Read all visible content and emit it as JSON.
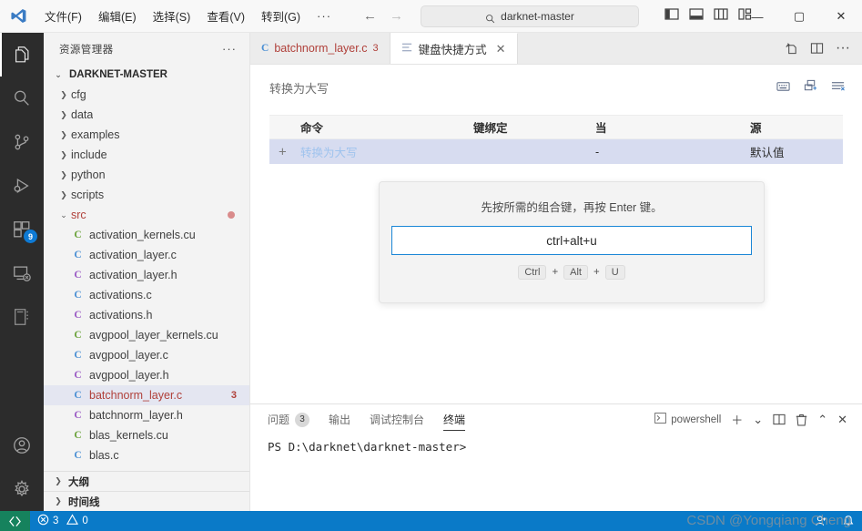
{
  "titlebar": {
    "menus": [
      "文件(F)",
      "编辑(E)",
      "选择(S)",
      "查看(V)",
      "转到(G)"
    ],
    "more": "···",
    "back_arrow": "←",
    "forward_arrow": "→",
    "search_text": "darknet-master",
    "minimize": "—",
    "maximize": "▢",
    "close": "✕"
  },
  "activitybar": {
    "items": [
      {
        "name": "explorer",
        "active": true
      },
      {
        "name": "search",
        "active": false
      },
      {
        "name": "source-control",
        "active": false
      },
      {
        "name": "run-debug",
        "active": false
      },
      {
        "name": "extensions",
        "active": false,
        "badge": "9"
      },
      {
        "name": "remote-explorer",
        "active": false
      },
      {
        "name": "notebook",
        "active": false
      }
    ],
    "bottom": [
      {
        "name": "accounts"
      },
      {
        "name": "settings"
      }
    ]
  },
  "sidebar": {
    "title": "资源管理器",
    "more": "···",
    "root": "DARKNET-MASTER",
    "folders": [
      {
        "label": "cfg"
      },
      {
        "label": "data"
      },
      {
        "label": "examples"
      },
      {
        "label": "include"
      },
      {
        "label": "python"
      },
      {
        "label": "scripts"
      },
      {
        "label": "src",
        "expanded": true,
        "dirty": true
      }
    ],
    "files": [
      {
        "label": "activation_kernels.cu",
        "kind": "cu"
      },
      {
        "label": "activation_layer.c",
        "kind": "c"
      },
      {
        "label": "activation_layer.h",
        "kind": "h"
      },
      {
        "label": "activations.c",
        "kind": "c"
      },
      {
        "label": "activations.h",
        "kind": "h"
      },
      {
        "label": "avgpool_layer_kernels.cu",
        "kind": "cu"
      },
      {
        "label": "avgpool_layer.c",
        "kind": "c"
      },
      {
        "label": "avgpool_layer.h",
        "kind": "h"
      },
      {
        "label": "batchnorm_layer.c",
        "kind": "c",
        "selected": true,
        "modified": true,
        "badge": "3"
      },
      {
        "label": "batchnorm_layer.h",
        "kind": "h"
      },
      {
        "label": "blas_kernels.cu",
        "kind": "cu"
      },
      {
        "label": "blas.c",
        "kind": "c"
      }
    ],
    "sections": [
      "大纲",
      "时间线"
    ]
  },
  "tabs": [
    {
      "label": "batchnorm_layer.c",
      "icon": "c",
      "badge": "3",
      "active": false,
      "modified": true
    },
    {
      "label": "键盘快捷方式",
      "icon": "keybindings",
      "active": true,
      "close": "✕"
    }
  ],
  "tab_actions": [
    "split-editor-right-icon",
    "split-editor-icon",
    "more-actions-icon"
  ],
  "keybindings": {
    "search_value": "转换为大写",
    "top_icons": [
      "keyboard-icon",
      "record-keys-icon",
      "clear-filter-icon"
    ],
    "columns": [
      "命令",
      "键绑定",
      "当",
      "源"
    ],
    "rows": [
      {
        "command": "转换为大写",
        "keybinding": "",
        "when": "-",
        "source": "默认值",
        "selected": true
      }
    ],
    "dialog": {
      "message": "先按所需的组合键，再按 Enter 键。",
      "value": "ctrl+alt+u",
      "chips": [
        "Ctrl",
        "Alt",
        "U"
      ],
      "plus": "+"
    }
  },
  "panel": {
    "tabs": [
      {
        "label": "问题",
        "count": "3",
        "active": false
      },
      {
        "label": "输出",
        "active": false
      },
      {
        "label": "调试控制台",
        "active": false
      },
      {
        "label": "终端",
        "active": true
      }
    ],
    "shell": "powershell",
    "actions": [
      "new-terminal-icon",
      "terminal-dropdown-icon",
      "split-terminal-icon",
      "kill-terminal-icon",
      "maximize-panel-icon",
      "close-panel-icon"
    ],
    "terminal_line": "PS D:\\darknet\\darknet-master>"
  },
  "statusbar": {
    "remote_icon": "remote-window-icon",
    "errors": "3",
    "warnings": "0",
    "right_icons": [
      "account-icon",
      "notifications-bell-icon"
    ]
  },
  "watermark": "CSDN @Yongqiang Cheng",
  "colors": {
    "accent_blue": "#0a7ac8",
    "remote_green": "#16825d",
    "modified_red": "#b0403a",
    "selection_lavender": "#d7dcf0",
    "focus_border": "#1a86d6"
  }
}
